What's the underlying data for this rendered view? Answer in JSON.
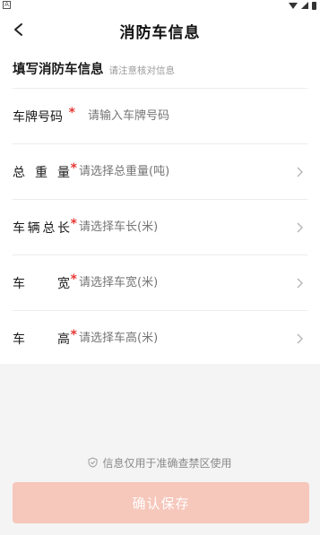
{
  "status_bar": {
    "left_icon": "A"
  },
  "header": {
    "title": "消防车信息"
  },
  "section": {
    "title": "填写消防车信息",
    "subtitle": "请注意核对信息"
  },
  "fields": {
    "plate": {
      "label_chars": [
        "车",
        "牌",
        "号",
        "码"
      ],
      "required": "*",
      "placeholder": "请输入车牌号码"
    },
    "weight": {
      "label_chars": [
        "总",
        "重",
        "量"
      ],
      "required": "*",
      "placeholder": "请选择总重量(吨)"
    },
    "length": {
      "label_chars": [
        "车",
        "辆",
        "总",
        "长"
      ],
      "required": "*",
      "placeholder": "请选择车长(米)"
    },
    "width": {
      "label_chars": [
        "车",
        "宽"
      ],
      "required": "*",
      "placeholder": "请选择车宽(米)"
    },
    "height": {
      "label_chars": [
        "车",
        "高"
      ],
      "required": "*",
      "placeholder": "请选择车高(米)"
    }
  },
  "notice": {
    "text": "信息仅用于准确查禁区使用",
    "icon": "shield-check-icon"
  },
  "submit": {
    "label": "确认保存",
    "color": "#f6c7bb"
  },
  "colors": {
    "required": "#e53935",
    "placeholder": "#a8a8a8"
  }
}
